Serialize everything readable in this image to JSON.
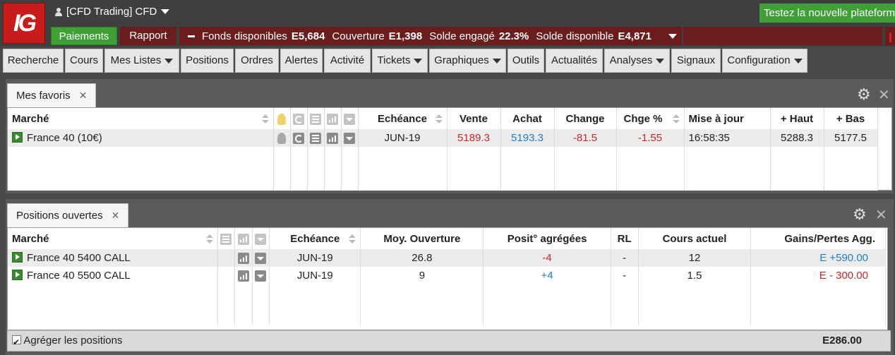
{
  "header": {
    "logo_text": "IG",
    "account_label": "[CFD Trading] CFD",
    "new_platform_button": "Testez la nouvelle plateform",
    "paiements_button": "Paiements",
    "rapport_button": "Rapport",
    "funds": {
      "fonds_label": "Fonds disponibles",
      "fonds_value": "E5,684",
      "couverture_label": "Couverture",
      "couverture_value": "E1,398",
      "solde_engage_label": "Solde engagé",
      "solde_engage_value": "22.3%",
      "solde_dispo_label": "Solde disponible",
      "solde_dispo_value": "E4,871"
    }
  },
  "menu": [
    {
      "label": "Recherche",
      "dropdown": false
    },
    {
      "label": "Cours",
      "dropdown": false
    },
    {
      "label": "Mes Listes",
      "dropdown": true
    },
    {
      "label": "Positions",
      "dropdown": false
    },
    {
      "label": "Ordres",
      "dropdown": false
    },
    {
      "label": "Alertes",
      "dropdown": false
    },
    {
      "label": "Activité",
      "dropdown": false
    },
    {
      "label": "Tickets",
      "dropdown": true
    },
    {
      "label": "Graphiques",
      "dropdown": true
    },
    {
      "label": "Outils",
      "dropdown": false
    },
    {
      "label": "Actualités",
      "dropdown": false
    },
    {
      "label": "Analyses",
      "dropdown": true
    },
    {
      "label": "Signaux",
      "dropdown": false
    },
    {
      "label": "Configuration",
      "dropdown": true
    }
  ],
  "favorites": {
    "tab_label": "Mes favoris",
    "tab_close": "✕",
    "columns": {
      "marche": "Marché",
      "echeance": "Echéance",
      "vente": "Vente",
      "achat": "Achat",
      "change": "Change",
      "chge_pct": "Chge %",
      "mise_a_jour": "Mise à jour",
      "haut": "+ Haut",
      "bas": "+ Bas"
    },
    "rows": [
      {
        "marche": "France 40 (10€)",
        "echeance": "JUN-19",
        "vente": "5189.3",
        "achat": "5193.3",
        "change": "-81.5",
        "chge_pct": "-1.55",
        "mise_a_jour": "16:58:35",
        "haut": "5288.3",
        "bas": "5177.5"
      }
    ]
  },
  "positions": {
    "tab_label": "Positions ouvertes",
    "tab_close": "✕",
    "columns": {
      "marche": "Marché",
      "echeance": "Echéance",
      "moy_ouverture": "Moy. Ouverture",
      "posit_agregees": "Posit° agrégées",
      "rl": "RL",
      "cours_actuel": "Cours actuel",
      "gains_pertes": "Gains/Pertes Agg."
    },
    "rows": [
      {
        "marche": "France 40 5400 CALL",
        "echeance": "JUN-19",
        "moy_ouverture": "26.8",
        "posit_agregees": "-4",
        "rl": "-",
        "cours_actuel": "12",
        "gains_pertes": "E +590.00"
      },
      {
        "marche": "France 40 5500 CALL",
        "echeance": "JUN-19",
        "moy_ouverture": "9",
        "posit_agregees": "+4",
        "rl": "-",
        "cours_actuel": "1.5",
        "gains_pertes": "E - 300.00"
      }
    ],
    "footer": {
      "aggregate_label": "Agréger les positions",
      "total": "E286.00"
    }
  },
  "colors": {
    "brand_red": "#c81b1b",
    "green": "#3fa037",
    "negative": "#c62828",
    "positive": "#1e7fc4"
  }
}
